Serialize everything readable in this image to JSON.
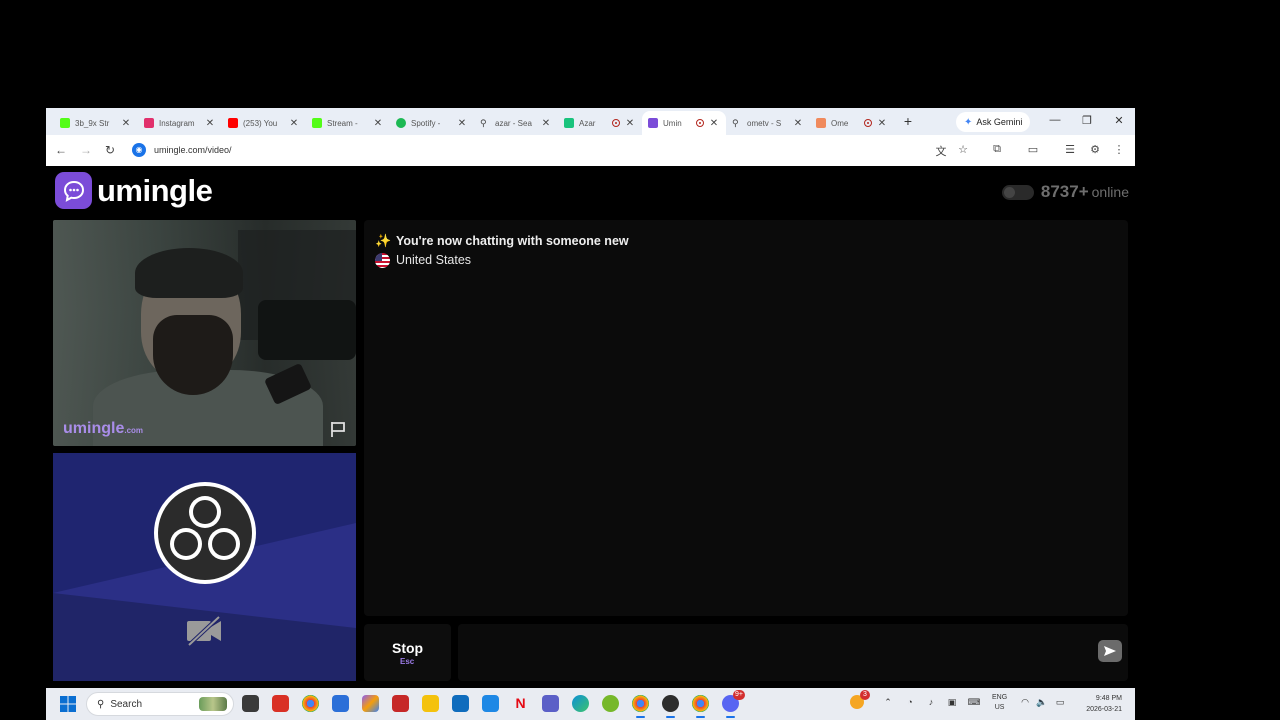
{
  "browser": {
    "tabs": [
      {
        "title": "3b_9x Str",
        "favicon_color": "#1db954",
        "recording": false,
        "active": false
      },
      {
        "title": "Instagram",
        "favicon_color": "#e1306c",
        "recording": false,
        "active": false
      },
      {
        "title": "(253) You",
        "favicon_color": "#ff0000",
        "recording": false,
        "active": false
      },
      {
        "title": "Stream - ",
        "favicon_color": "#53fc18",
        "recording": false,
        "active": false
      },
      {
        "title": "Spotify - ",
        "favicon_color": "#1db954",
        "recording": false,
        "active": false
      },
      {
        "title": "azar - Sea",
        "favicon_color": "#e9eef6",
        "recording": false,
        "active": false
      },
      {
        "title": "Azar",
        "favicon_color": "#19c37d",
        "recording": true,
        "active": false
      },
      {
        "title": "Umin",
        "favicon_color": "#7b4cd8",
        "recording": true,
        "active": true
      },
      {
        "title": "ometv - S",
        "favicon_color": "#e9eef6",
        "recording": false,
        "active": false
      },
      {
        "title": "Ome",
        "favicon_color": "#f08a5d",
        "recording": true,
        "active": false
      }
    ],
    "new_tab": "+",
    "gemini_label": "Ask Gemini",
    "url": "umingle.com/video/"
  },
  "page": {
    "logo_text": "umingle",
    "online_count": "8737+",
    "online_label": "online",
    "watermark": "umingle",
    "watermark_suffix": ".com",
    "chat_status": "You're now chatting with someone new",
    "chat_country": "United States",
    "stop_label": "Stop",
    "stop_key": "Esc",
    "chat_input_value": ""
  },
  "taskbar": {
    "search_label": "Search",
    "lang_line1": "ENG",
    "lang_line2": "US",
    "time": "9:48 PM",
    "date": "2026-03-21",
    "apps": [
      {
        "name": "file-explorer",
        "color": "#3a3a3a",
        "badge": ""
      },
      {
        "name": "app-red",
        "color": "#d93025",
        "badge": ""
      },
      {
        "name": "chrome",
        "color": "#4285f4",
        "badge": ""
      },
      {
        "name": "store",
        "color": "#2b6fd8",
        "badge": ""
      },
      {
        "name": "copilot",
        "color": "#8b5cf6",
        "badge": ""
      },
      {
        "name": "app-l",
        "color": "#c62828",
        "badge": ""
      },
      {
        "name": "folder",
        "color": "#f4c20d",
        "badge": ""
      },
      {
        "name": "outlook",
        "color": "#0f6cbd",
        "badge": ""
      },
      {
        "name": "app-blue",
        "color": "#1e88e5",
        "badge": ""
      },
      {
        "name": "netflix",
        "color": "#111111",
        "badge": ""
      },
      {
        "name": "teams",
        "color": "#5b5fc7",
        "badge": ""
      },
      {
        "name": "edge",
        "color": "#0c8fd6",
        "badge": ""
      },
      {
        "name": "utorrent",
        "color": "#76b82a",
        "badge": ""
      },
      {
        "name": "chrome-profile",
        "color": "#4285f4",
        "badge": ""
      },
      {
        "name": "obs",
        "color": "#2d2d2d",
        "badge": ""
      },
      {
        "name": "chrome-profile-2",
        "color": "#34a853",
        "badge": ""
      },
      {
        "name": "discord",
        "color": "#5865f2",
        "badge": "9+"
      }
    ],
    "weather_badge": "3"
  },
  "colors": {
    "brand": "#7b4cd8",
    "local_video_bg": "#1e236a"
  }
}
